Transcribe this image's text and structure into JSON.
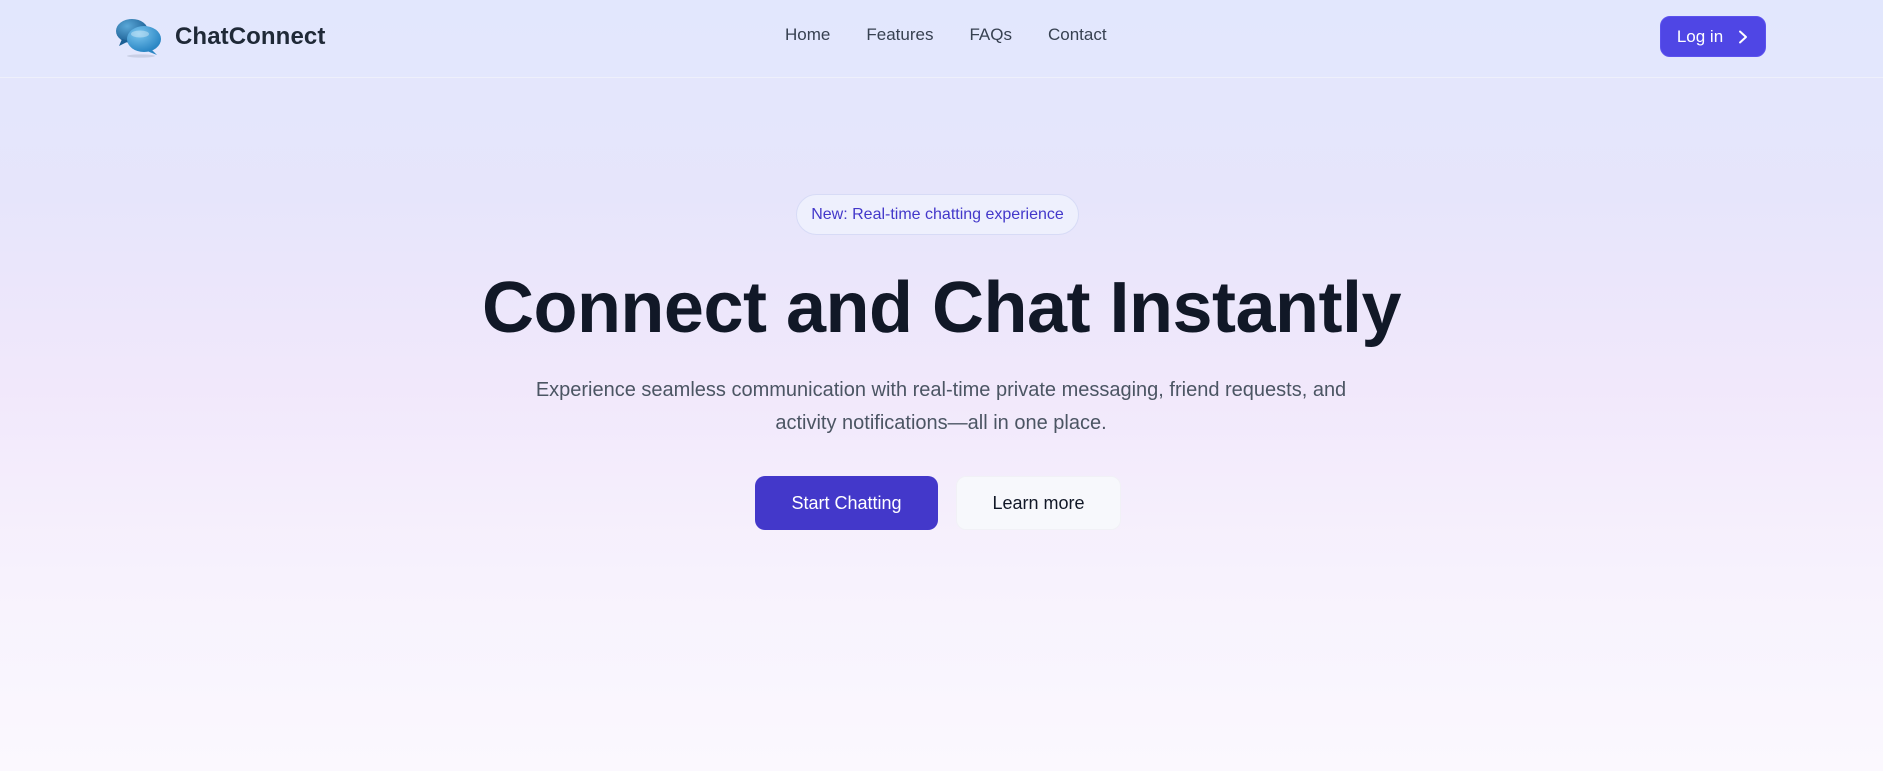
{
  "header": {
    "brand_name": "ChatConnect",
    "logo_icon": "chat-bubbles-icon",
    "nav": [
      {
        "label": "Home"
      },
      {
        "label": "Features"
      },
      {
        "label": "FAQs"
      },
      {
        "label": "Contact"
      }
    ],
    "login_label": "Log in",
    "login_icon": "chevron-right-icon"
  },
  "hero": {
    "badge": "New: Real-time chatting experience",
    "headline": "Connect and Chat Instantly",
    "subtext": "Experience seamless communication with real-time private messaging, friend requests, and activity notifications—all in one place.",
    "primary_cta": "Start Chatting",
    "secondary_cta": "Learn more"
  },
  "colors": {
    "accent": "#4f46e5",
    "primary_button": "#4338ca",
    "badge_text": "#4338ca",
    "heading": "#111827",
    "body_text": "#4b5563"
  }
}
